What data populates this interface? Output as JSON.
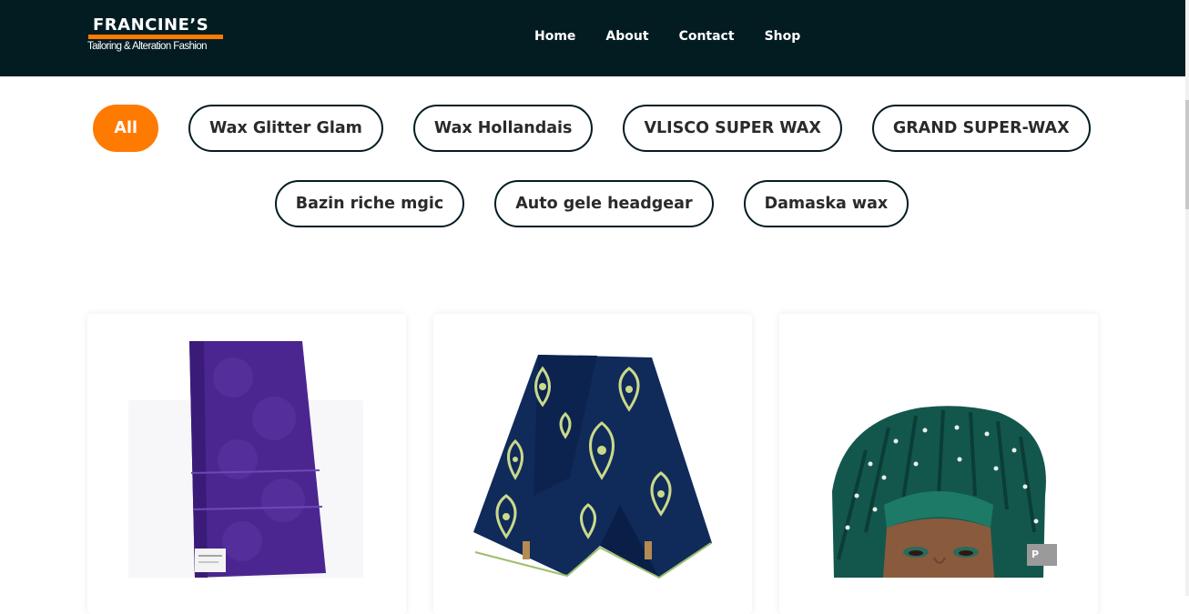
{
  "header": {
    "logo": {
      "name": "FRANCINE’S",
      "tagline": "Tailoring & Alteration Fashion"
    },
    "nav": [
      "Home",
      "About",
      "Contact",
      "Shop"
    ]
  },
  "filters": {
    "active": "All",
    "row1": [
      "All",
      "Wax Glitter Glam",
      "Wax Hollandais",
      "VLISCO SUPER WAX",
      "GRAND SUPER-WAX"
    ],
    "row2": [
      "Bazin riche mgic",
      "Auto gele headgear",
      "Damaska wax"
    ]
  },
  "products": [
    {
      "image": "purple-bazin-fabric-image"
    },
    {
      "image": "navy-wax-print-fabric-image"
    },
    {
      "image": "green-auto-gele-headgear-image",
      "badge": "P"
    }
  ],
  "colors": {
    "header_bg": "#021c22",
    "accent": "#ff7a00",
    "pill_border": "#021c22"
  }
}
